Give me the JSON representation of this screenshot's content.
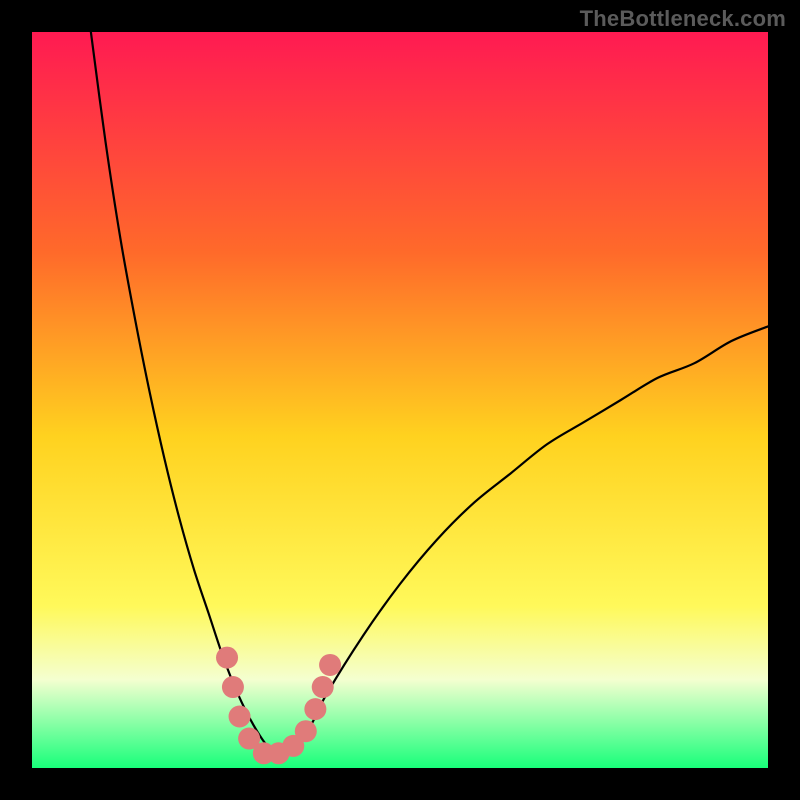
{
  "watermark": "TheBottleneck.com",
  "colors": {
    "frame": "#000000",
    "gradient_top": "#ff1a52",
    "gradient_mid1": "#ff6a2a",
    "gradient_mid2": "#ffd21f",
    "gradient_mid3": "#fff95a",
    "gradient_band": "#f4ffd0",
    "gradient_bottom": "#18ff7a",
    "curve": "#000000",
    "marker": "#e07b7a"
  },
  "chart_data": {
    "type": "line",
    "title": "",
    "xlabel": "",
    "ylabel": "",
    "xlim": [
      0,
      100
    ],
    "ylim": [
      0,
      100
    ],
    "grid": false,
    "curve_note": "V-shaped bottleneck curve; minimum near x≈32; left branch rises to ~100 at x≈8; right branch rises to ~60 at x≈100.",
    "series": [
      {
        "name": "bottleneck-curve",
        "x": [
          8,
          10,
          12,
          14,
          16,
          18,
          20,
          22,
          24,
          26,
          28,
          30,
          32,
          34,
          36,
          38,
          40,
          45,
          50,
          55,
          60,
          65,
          70,
          75,
          80,
          85,
          90,
          95,
          100
        ],
        "y": [
          100,
          85,
          72,
          61,
          51,
          42,
          34,
          27,
          21,
          15,
          10,
          6,
          3,
          2,
          3,
          6,
          10,
          18,
          25,
          31,
          36,
          40,
          44,
          47,
          50,
          53,
          55,
          58,
          60
        ]
      }
    ],
    "markers": [
      {
        "x": 26.5,
        "y": 15
      },
      {
        "x": 27.3,
        "y": 11
      },
      {
        "x": 28.2,
        "y": 7
      },
      {
        "x": 29.5,
        "y": 4
      },
      {
        "x": 31.5,
        "y": 2
      },
      {
        "x": 33.5,
        "y": 2
      },
      {
        "x": 35.5,
        "y": 3
      },
      {
        "x": 37.2,
        "y": 5
      },
      {
        "x": 38.5,
        "y": 8
      },
      {
        "x": 39.5,
        "y": 11
      },
      {
        "x": 40.5,
        "y": 14
      }
    ]
  }
}
